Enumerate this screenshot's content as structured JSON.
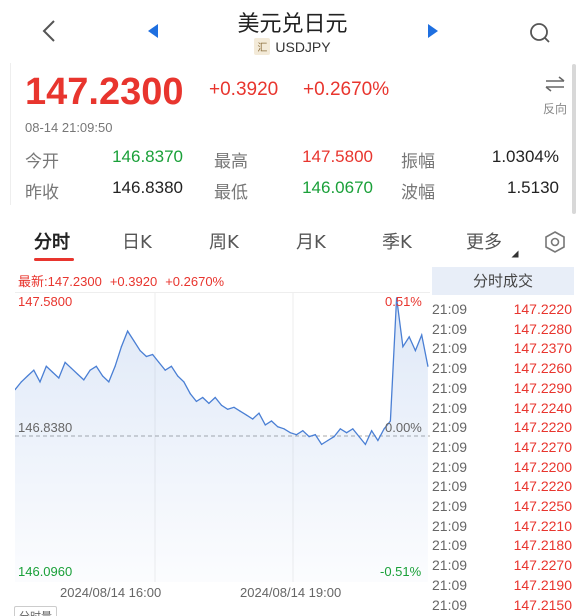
{
  "header": {
    "title": "美元兑日元",
    "symbol_tag": "汇",
    "symbol": "USDJPY"
  },
  "quote": {
    "price": "147.2300",
    "change": "+0.3920",
    "change_pct": "+0.2670%",
    "time": "08-14 21:09:50",
    "reverse_label": "反向"
  },
  "stats": [
    {
      "label": "今开",
      "value": "146.8370",
      "color": "#1aa039"
    },
    {
      "label": "最高",
      "value": "147.5800",
      "color": "#e8352e"
    },
    {
      "label": "振幅",
      "value": "1.0304%",
      "color": "#222222"
    },
    {
      "label": "昨收",
      "value": "146.8380",
      "color": "#222222"
    },
    {
      "label": "最低",
      "value": "146.0670",
      "color": "#1aa039"
    },
    {
      "label": "波幅",
      "value": "1.5130",
      "color": "#222222"
    }
  ],
  "tabs": [
    "分时",
    "日K",
    "周K",
    "月K",
    "季K",
    "更多"
  ],
  "chart_info": {
    "latest": "最新:147.2300",
    "change": "+0.3920",
    "change_pct": "+0.2670%",
    "y_high": "147.5800",
    "y_mid": "146.8380",
    "y_low": "146.0960",
    "pct_high": "0.51%",
    "pct_mid": "0.00%",
    "pct_low": "-0.51%",
    "date1": "2024/08/14 16:00",
    "date2": "2024/08/14 19:00",
    "bottom_tag": "分时量"
  },
  "chart_data": {
    "type": "line",
    "x": [
      "2024/08/14 16:00",
      "2024/08/14 19:00"
    ],
    "ylim": [
      146.096,
      147.58
    ],
    "baseline": 146.838,
    "series": [
      {
        "values": [
          147.08,
          147.12,
          147.15,
          147.18,
          147.12,
          147.2,
          147.17,
          147.14,
          147.22,
          147.19,
          147.16,
          147.13,
          147.18,
          147.2,
          147.15,
          147.12,
          147.2,
          147.3,
          147.38,
          147.33,
          147.28,
          147.25,
          147.26,
          147.22,
          147.18,
          147.2,
          147.15,
          147.12,
          147.06,
          147.02,
          147.04,
          147.01,
          147.04,
          147.0,
          146.98,
          146.99,
          146.97,
          146.95,
          146.93,
          146.96,
          146.9,
          146.92,
          146.89,
          146.88,
          146.86,
          146.85,
          146.87,
          146.84,
          146.85,
          146.8,
          146.82,
          146.84,
          146.88,
          146.86,
          146.88,
          146.84,
          146.8,
          146.87,
          146.82,
          146.88,
          146.92,
          147.55,
          147.3,
          147.35,
          147.28,
          147.36,
          147.2
        ]
      }
    ]
  },
  "trades": {
    "title": "分时成交",
    "rows": [
      {
        "time": "21:09",
        "price": "147.2220"
      },
      {
        "time": "21:09",
        "price": "147.2280"
      },
      {
        "time": "21:09",
        "price": "147.2370"
      },
      {
        "time": "21:09",
        "price": "147.2260"
      },
      {
        "time": "21:09",
        "price": "147.2290"
      },
      {
        "time": "21:09",
        "price": "147.2240"
      },
      {
        "time": "21:09",
        "price": "147.2220"
      },
      {
        "time": "21:09",
        "price": "147.2270"
      },
      {
        "time": "21:09",
        "price": "147.2200"
      },
      {
        "time": "21:09",
        "price": "147.2220"
      },
      {
        "time": "21:09",
        "price": "147.2250"
      },
      {
        "time": "21:09",
        "price": "147.2210"
      },
      {
        "time": "21:09",
        "price": "147.2180"
      },
      {
        "time": "21:09",
        "price": "147.2270"
      },
      {
        "time": "21:09",
        "price": "147.2190"
      },
      {
        "time": "21:09",
        "price": "147.2150"
      }
    ]
  },
  "colors": {
    "up": "#e8352e",
    "down": "#1aa039",
    "accent": "#1e6fe0",
    "line": "#4a7fd4"
  }
}
